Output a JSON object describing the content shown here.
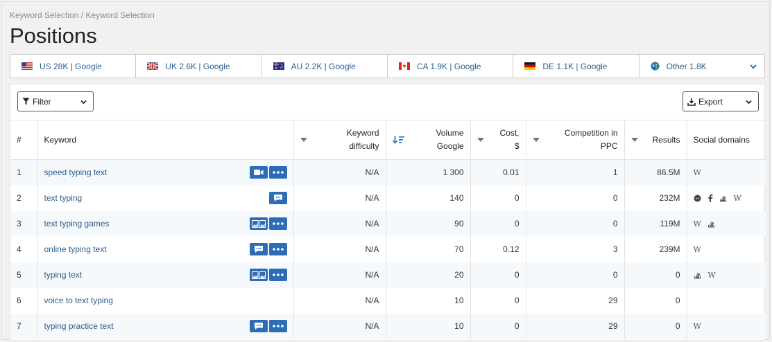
{
  "breadcrumb": "Keyword Selection / Keyword Selection",
  "title": "Positions",
  "tabs": [
    {
      "label": "US 28K | Google",
      "flag": "us-flag-icon"
    },
    {
      "label": "UK 2.6K | Google",
      "flag": "uk-flag-icon"
    },
    {
      "label": "AU 2.2K | Google",
      "flag": "au-flag-icon"
    },
    {
      "label": "CA 1.9K | Google",
      "flag": "ca-flag-icon"
    },
    {
      "label": "DE 1.1K | Google",
      "flag": "de-flag-icon"
    },
    {
      "label": "Other 1.8K",
      "flag": "globe-icon"
    }
  ],
  "toolbar": {
    "filter_label": "Filter",
    "export_label": "Export"
  },
  "columns": {
    "index": "#",
    "keyword": "Keyword",
    "difficulty_1": "Keyword",
    "difficulty_2": "difficulty",
    "volume_1": "Volume",
    "volume_2": "Google",
    "cost_1": "Cost,",
    "cost_2": "$",
    "competition_1": "Competition in",
    "competition_2": "PPC",
    "results": "Results",
    "social": "Social domains"
  },
  "rows": [
    {
      "index": "1",
      "keyword": "speed typing text",
      "difficulty": "N/A",
      "volume": "1 300",
      "cost": "0.01",
      "competition": "1",
      "results": "86.5M"
    },
    {
      "index": "2",
      "keyword": "text typing",
      "difficulty": "N/A",
      "volume": "140",
      "cost": "0",
      "competition": "0",
      "results": "232M"
    },
    {
      "index": "3",
      "keyword": "text typing games",
      "difficulty": "N/A",
      "volume": "90",
      "cost": "0",
      "competition": "0",
      "results": "119M"
    },
    {
      "index": "4",
      "keyword": "online typing text",
      "difficulty": "N/A",
      "volume": "70",
      "cost": "0.12",
      "competition": "3",
      "results": "239M"
    },
    {
      "index": "5",
      "keyword": "typing text",
      "difficulty": "N/A",
      "volume": "20",
      "cost": "0",
      "competition": "0",
      "results": "0"
    },
    {
      "index": "6",
      "keyword": "voice to text typing",
      "difficulty": "N/A",
      "volume": "10",
      "cost": "0",
      "competition": "29",
      "results": "0"
    },
    {
      "index": "7",
      "keyword": "typing practice text",
      "difficulty": "N/A",
      "volume": "10",
      "cost": "0",
      "competition": "29",
      "results": "0"
    }
  ],
  "colors": {
    "accent": "#2d6db5",
    "link": "#2b5f8f"
  }
}
